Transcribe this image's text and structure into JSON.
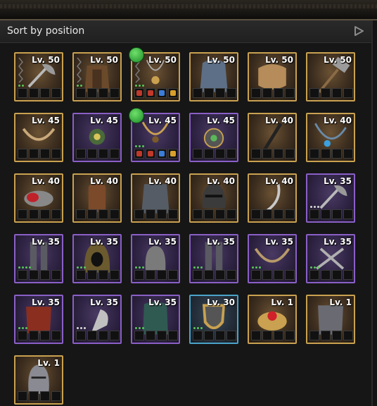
{
  "header": {
    "sort_label": "Sort by position"
  },
  "items": [
    {
      "level": "Lv. 50",
      "rarity": "legendary",
      "icon": "axe-icon",
      "chain": true,
      "dots": "gg"
    },
    {
      "level": "Lv. 50",
      "rarity": "legendary",
      "icon": "leather-armor-icon",
      "chain": true,
      "dots": "gg"
    },
    {
      "level": "Lv. 50",
      "rarity": "legendary",
      "icon": "amulet-icon",
      "chain": true,
      "dots": "ggg",
      "gems": [
        "#c0392b",
        "#c0392b",
        "#3b7dd8",
        "#d9a02b"
      ],
      "badge": true
    },
    {
      "level": "Lv. 50",
      "rarity": "legendary",
      "icon": "cloak-icon"
    },
    {
      "level": "Lv. 50",
      "rarity": "legendary",
      "icon": "wrap-icon"
    },
    {
      "level": "Lv. 50",
      "rarity": "legendary",
      "icon": "hammer-icon"
    },
    {
      "level": "Lv. 45",
      "rarity": "legendary",
      "icon": "tooth-necklace-icon"
    },
    {
      "level": "Lv. 45",
      "rarity": "epic",
      "icon": "medallion-icon"
    },
    {
      "level": "Lv. 45",
      "rarity": "epic",
      "icon": "necklace-icon",
      "dots": "ggg",
      "gems": [
        "#c0392b",
        "#c0392b",
        "#3b7dd8",
        "#d9a02b"
      ],
      "badge": true
    },
    {
      "level": "Lv. 45",
      "rarity": "epic",
      "icon": "ornament-icon"
    },
    {
      "level": "Lv. 40",
      "rarity": "legendary",
      "icon": "quill-icon"
    },
    {
      "level": "Lv. 40",
      "rarity": "legendary",
      "icon": "gem-necklace-icon"
    },
    {
      "level": "Lv. 40",
      "rarity": "legendary",
      "icon": "ring-icon"
    },
    {
      "level": "Lv. 40",
      "rarity": "legendary",
      "icon": "bracer-icon"
    },
    {
      "level": "Lv. 40",
      "rarity": "legendary",
      "icon": "chainmail-icon"
    },
    {
      "level": "Lv. 40",
      "rarity": "legendary",
      "icon": "helmet-icon"
    },
    {
      "level": "Lv. 40",
      "rarity": "legendary",
      "icon": "blade-icon"
    },
    {
      "level": "Lv. 35",
      "rarity": "epic",
      "icon": "axe-icon",
      "dots": "www"
    },
    {
      "level": "Lv. 35",
      "rarity": "epic",
      "icon": "greaves-icon",
      "dots": "gggg"
    },
    {
      "level": "Lv. 35",
      "rarity": "epic",
      "icon": "hood-icon",
      "dots": "ggg"
    },
    {
      "level": "Lv. 35",
      "rarity": "epic",
      "icon": "helm-icon",
      "dots": "ggg"
    },
    {
      "level": "Lv. 35",
      "rarity": "epic",
      "icon": "greaves-icon",
      "dots": "ggg"
    },
    {
      "level": "Lv. 35",
      "rarity": "epic",
      "icon": "claw-necklace-icon",
      "dots": "ggg"
    },
    {
      "level": "Lv. 35",
      "rarity": "epic",
      "icon": "daggers-icon",
      "dots": "ggg"
    },
    {
      "level": "Lv. 35",
      "rarity": "epic",
      "icon": "red-armor-icon",
      "dots": "ggg"
    },
    {
      "level": "Lv. 35",
      "rarity": "epic",
      "icon": "cleaver-icon",
      "dots": "www"
    },
    {
      "level": "Lv. 35",
      "rarity": "epic",
      "icon": "green-cloak-icon",
      "dots": "ggg"
    },
    {
      "level": "Lv. 30",
      "rarity": "rare",
      "icon": "shield-icon",
      "dots": "ggg"
    },
    {
      "level": "Lv. 1",
      "rarity": "legendary",
      "icon": "ruby-ring-icon"
    },
    {
      "level": "Lv. 1",
      "rarity": "legendary",
      "icon": "plate-armor-icon"
    },
    {
      "level": "Lv. 1",
      "rarity": "legendary",
      "icon": "knight-helm-icon"
    }
  ]
}
